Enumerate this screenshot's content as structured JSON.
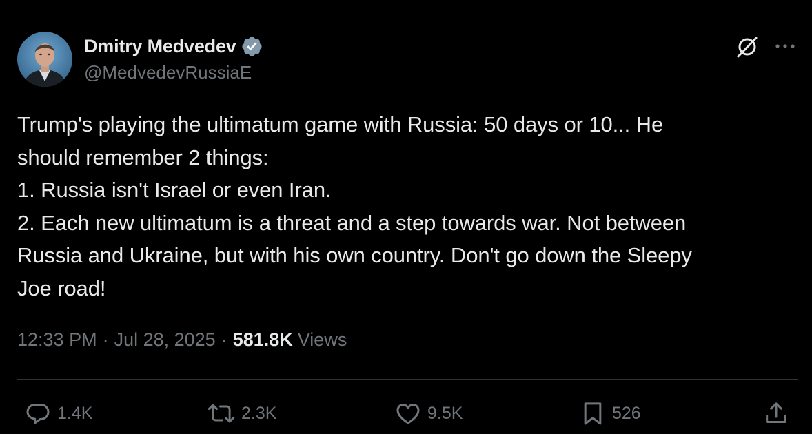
{
  "author": {
    "display_name": "Dmitry Medvedev",
    "handle": "@MedvedevRussiaE",
    "verified": true,
    "verified_color": "#829aab"
  },
  "tweet": {
    "text": "Trump's playing the ultimatum game with Russia: 50 days or 10... He\nshould remember 2 things:\n1. Russia isn't Israel or even Iran.\n2. Each new ultimatum is a threat and a step towards war. Not between\nRussia and Ukraine, but with his own country. Don't go down the Sleepy\nJoe road!"
  },
  "meta": {
    "time": "12:33 PM",
    "separator": "·",
    "date": "Jul 28, 2025",
    "views_count": "581.8K",
    "views_label": "Views"
  },
  "actions": {
    "replies": "1.4K",
    "reposts": "2.3K",
    "likes": "9.5K",
    "bookmarks": "526"
  },
  "icons": {
    "header_right": [
      "grok-icon",
      "more-icon"
    ],
    "actions": [
      "reply-icon",
      "repost-icon",
      "like-icon",
      "bookmark-icon",
      "share-icon"
    ]
  },
  "colors": {
    "background": "#000000",
    "primary_text": "#e7e9ea",
    "secondary_text": "#71767b",
    "divider": "#2f3336"
  }
}
